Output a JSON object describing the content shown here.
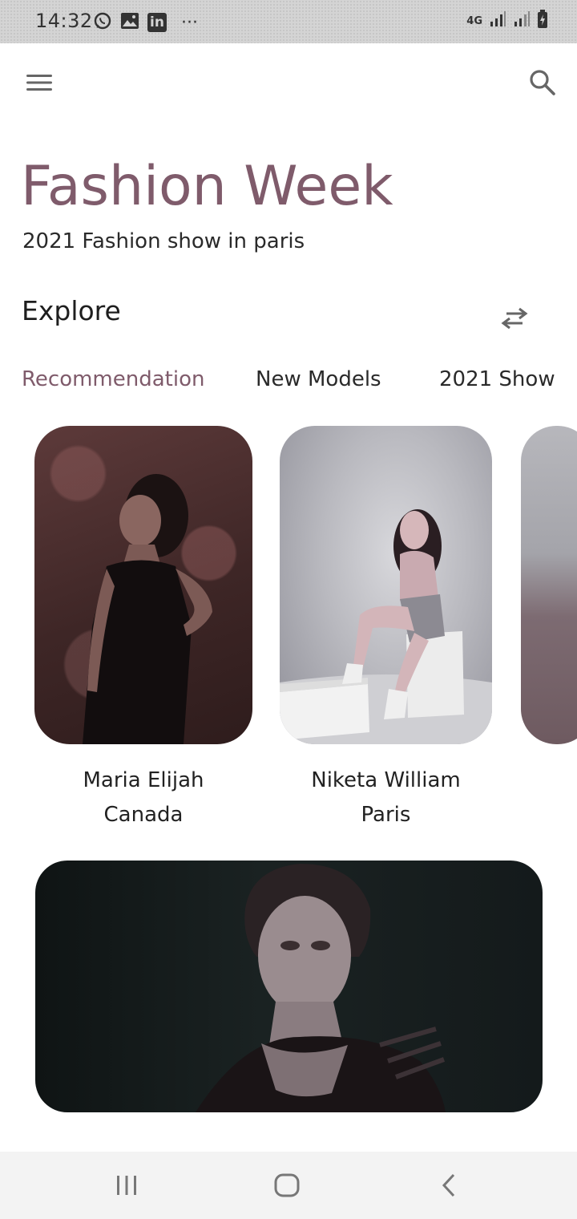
{
  "status_bar": {
    "time": "14:32",
    "left_icons": [
      "whatsapp-icon",
      "gallery-icon",
      "linkedin-icon",
      "more-dots-icon"
    ],
    "right_icons": [
      "network-4g-icon",
      "signal-icon",
      "signal-icon",
      "battery-charging-icon"
    ],
    "network_label": "4G",
    "more_label": "···",
    "linkedin_label": "in"
  },
  "app_bar": {
    "menu_icon": "hamburger-menu-icon",
    "search_icon": "search-icon"
  },
  "header": {
    "title": "Fashion Week",
    "subtitle": "2021 Fashion show in paris"
  },
  "explore": {
    "title": "Explore",
    "toggle_icon": "swap-arrows-icon",
    "tabs": [
      {
        "label": "Recommendation",
        "active": true
      },
      {
        "label": "New Models",
        "active": false
      },
      {
        "label": "2021 Show",
        "active": false
      }
    ]
  },
  "models": [
    {
      "name": "Maria Elijah",
      "location": "Canada"
    },
    {
      "name": "Niketa William",
      "location": "Paris"
    }
  ],
  "nav_bar": {
    "icons": [
      "recent-apps-icon",
      "home-icon",
      "back-icon"
    ]
  },
  "colors": {
    "accent": "#7f5b6b",
    "text_primary": "#222222",
    "status_bar_bg": "#d4d4d4",
    "nav_bar_bg": "#f3f3f3"
  }
}
